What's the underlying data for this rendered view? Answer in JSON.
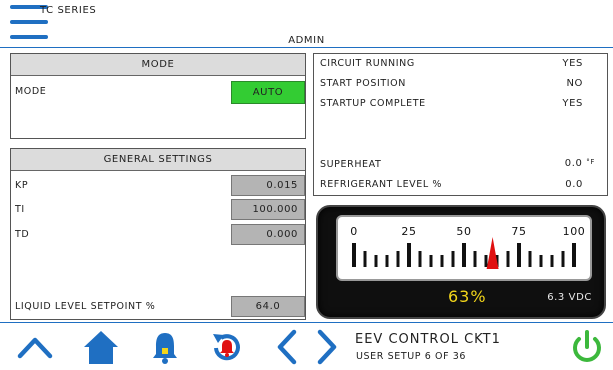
{
  "header": {
    "series": "TC SERIES",
    "role": "ADMIN",
    "accent": "#1f6fc2"
  },
  "mode_panel": {
    "title": "MODE",
    "label": "MODE",
    "value": "AUTO",
    "value_color": "#33cc33"
  },
  "status": {
    "circuit_running": {
      "label": "CIRCUIT RUNNING",
      "value": "YES"
    },
    "start_position": {
      "label": "START POSITION",
      "value": "NO"
    },
    "startup_complete": {
      "label": "STARTUP COMPLETE",
      "value": "YES"
    },
    "superheat": {
      "label": "SUPERHEAT",
      "value": "0.0",
      "unit": "°F"
    },
    "refrigerant_level": {
      "label": "REFRIGERANT LEVEL %",
      "value": "0.0"
    }
  },
  "general_settings": {
    "title": "GENERAL SETTINGS",
    "kp": {
      "label": "KP",
      "value": "0.015"
    },
    "ti": {
      "label": "TI",
      "value": "100.000"
    },
    "td": {
      "label": "TD",
      "value": "0.000"
    },
    "liquid_level": {
      "label": "LIQUID LEVEL SETPOINT %",
      "value": "64.0"
    }
  },
  "gauge": {
    "tick_labels": [
      "0",
      "25",
      "50",
      "75",
      "100"
    ],
    "percent_value": 63,
    "percent_text": "63%",
    "voltage_text": "6.3 VDC",
    "needle_color": "#e01010",
    "percent_color": "#f2d51a"
  },
  "footer": {
    "screen_title": "EEV CONTROL CKT1",
    "screen_sub": "USER SETUP 6 OF 36",
    "icons": [
      "chevron-up-icon",
      "home-icon",
      "bell-icon",
      "alarm-reset-icon",
      "chevron-left-icon",
      "chevron-right-icon",
      "power-icon"
    ]
  }
}
